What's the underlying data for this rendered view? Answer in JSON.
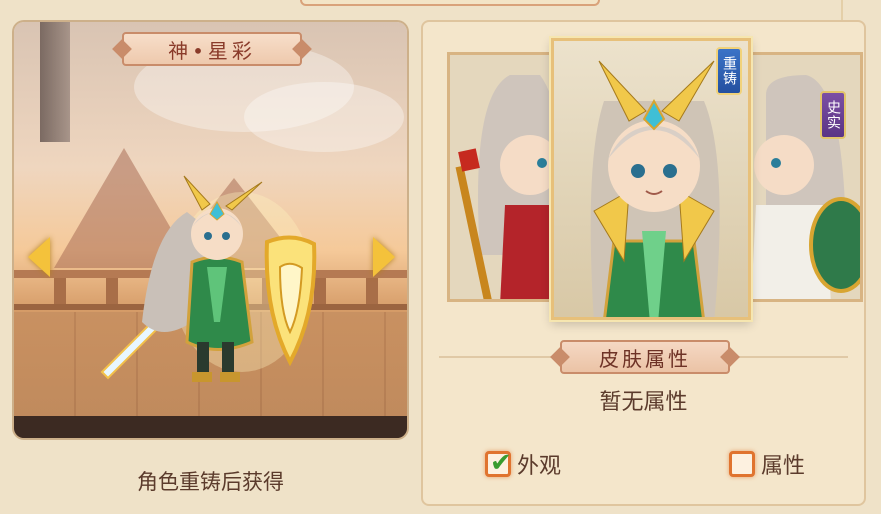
{
  "left_panel": {
    "title": "神•星彩",
    "obtain_text": "角色重铸后获得",
    "prev_icon": "arrow-left-icon",
    "next_icon": "arrow-right-icon"
  },
  "skins": {
    "center_badge": "重铸",
    "right_badge": "史实"
  },
  "attributes": {
    "section_title": "皮肤属性",
    "empty_text": "暂无属性"
  },
  "options": {
    "appearance_label": "外观",
    "appearance_checked": true,
    "attribute_label": "属性",
    "attribute_checked": false
  },
  "colors": {
    "accent_orange": "#e0742f",
    "check_green": "#3a9c2f",
    "badge_blue": "#2450a0",
    "badge_purple": "#5a3485"
  }
}
